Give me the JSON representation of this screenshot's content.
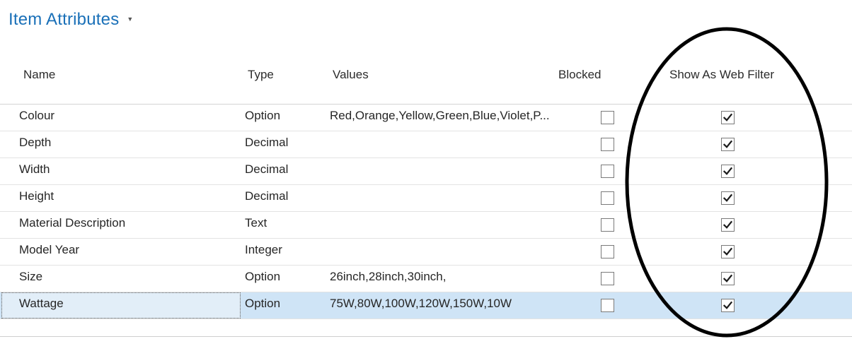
{
  "page": {
    "title": "Item Attributes"
  },
  "columns": {
    "name": "Name",
    "type": "Type",
    "values": "Values",
    "blocked": "Blocked",
    "show_as_web_filter": "Show As Web Filter"
  },
  "rows": [
    {
      "name": "Colour",
      "type": "Option",
      "values": "Red,Orange,Yellow,Green,Blue,Violet,P...",
      "blocked": false,
      "show_as_web_filter": true
    },
    {
      "name": "Depth",
      "type": "Decimal",
      "values": "",
      "blocked": false,
      "show_as_web_filter": true
    },
    {
      "name": "Width",
      "type": "Decimal",
      "values": "",
      "blocked": false,
      "show_as_web_filter": true
    },
    {
      "name": "Height",
      "type": "Decimal",
      "values": "",
      "blocked": false,
      "show_as_web_filter": true
    },
    {
      "name": "Material Description",
      "type": "Text",
      "values": "",
      "blocked": false,
      "show_as_web_filter": true
    },
    {
      "name": "Model Year",
      "type": "Integer",
      "values": "",
      "blocked": false,
      "show_as_web_filter": true
    },
    {
      "name": "Size",
      "type": "Option",
      "values": "26inch,28inch,30inch,",
      "blocked": false,
      "show_as_web_filter": true
    },
    {
      "name": "Wattage",
      "type": "Option",
      "values": "75W,80W,100W,120W,150W,10W",
      "blocked": false,
      "show_as_web_filter": true,
      "selected": true
    }
  ],
  "colors": {
    "title": "#1a70b8",
    "selected_row": "#cfe4f6",
    "annotation_ellipse": "#000000"
  },
  "icons": {
    "title_menu": "caret-down-icon",
    "checked": "checkmark-icon"
  }
}
